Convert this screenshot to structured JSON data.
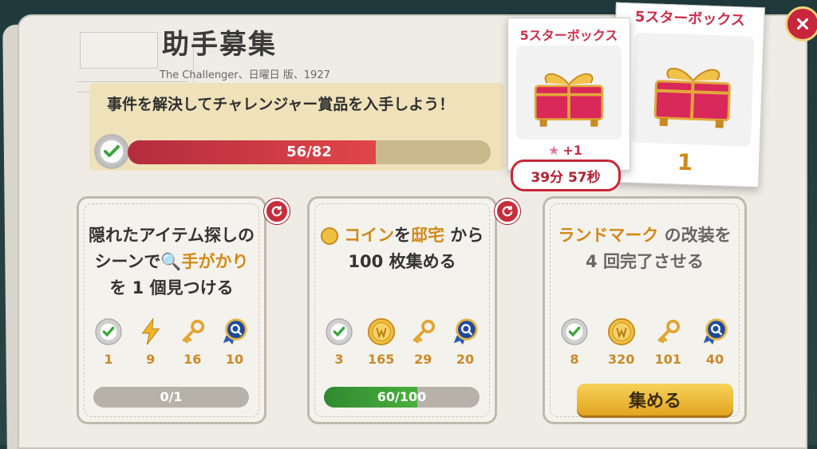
{
  "header": {
    "title": "助手募集",
    "subtitle": "The Challenger、日曜日 版、1927"
  },
  "banner": {
    "text": "事件を解決してチャレンジャー賞品を入手しよう！",
    "progress_label": "56/82",
    "progress": 0.683
  },
  "cards": [
    {
      "text_parts": [
        "隠れたアイテム探しのシーンで",
        "手がかり",
        "を 1 個見つける"
      ],
      "rewards": [
        {
          "icon": "check-badge-icon",
          "value": "1"
        },
        {
          "icon": "lightning-icon",
          "value": "9"
        },
        {
          "icon": "key-icon",
          "value": "16"
        },
        {
          "icon": "magnifier-medal-icon",
          "value": "10"
        }
      ],
      "progress_label": "0/1",
      "progress": 0
    },
    {
      "text_parts": [
        "コイン",
        "を",
        "邸宅",
        " から 100 枚集める"
      ],
      "rewards": [
        {
          "icon": "check-badge-icon",
          "value": "3"
        },
        {
          "icon": "coin-icon",
          "value": "165"
        },
        {
          "icon": "key-icon",
          "value": "29"
        },
        {
          "icon": "magnifier-medal-icon",
          "value": "20"
        }
      ],
      "progress_label": "60/100",
      "progress": 0.6
    },
    {
      "text_parts": [
        "ランドマーク",
        " の改装を 4 回完了させる"
      ],
      "rewards": [
        {
          "icon": "check-badge-icon",
          "value": "8"
        },
        {
          "icon": "coin-icon",
          "value": "320"
        },
        {
          "icon": "key-icon",
          "value": "101"
        },
        {
          "icon": "magnifier-medal-icon",
          "value": "40"
        }
      ],
      "button_label": "集める"
    }
  ],
  "boxes": {
    "current": {
      "title": "5スターボックス",
      "bonus": "+1",
      "timer": "39分 57秒"
    },
    "next": {
      "title": "5スターボックス",
      "count": "1"
    }
  },
  "colors": {
    "accent_gold": "#d08a19",
    "progress_red": "#e0464a",
    "progress_green": "#3a9a3a",
    "close_red": "#c8263a"
  }
}
